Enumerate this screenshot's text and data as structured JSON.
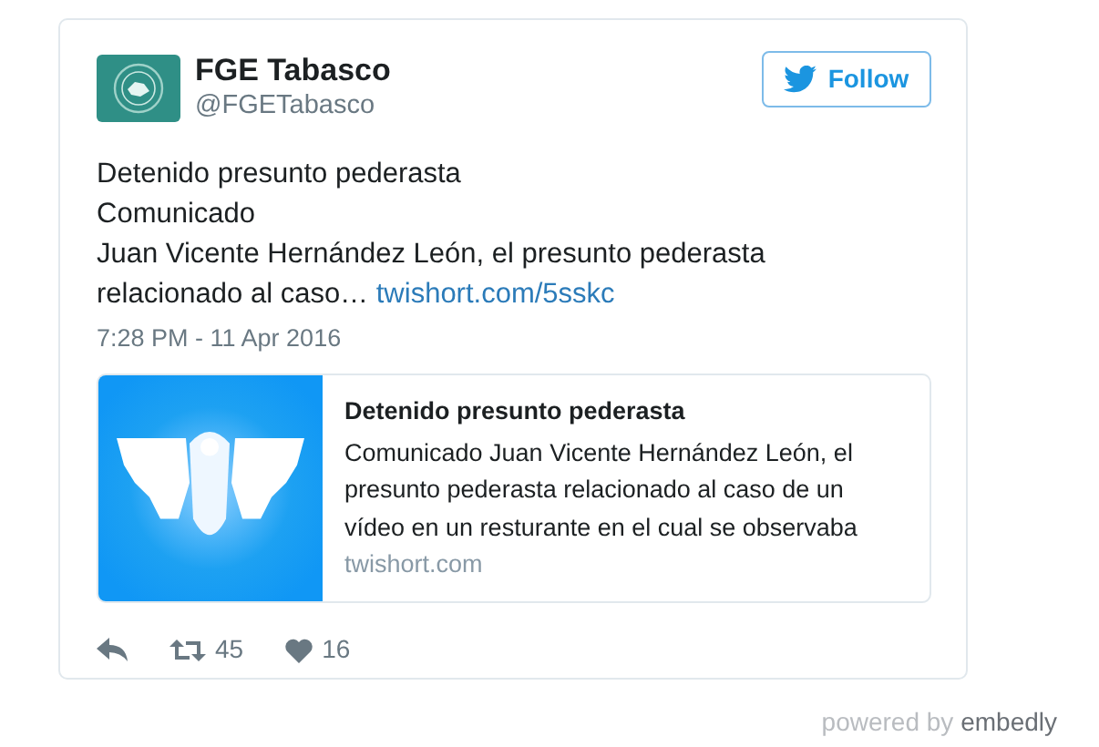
{
  "author": {
    "name": "FGE Tabasco",
    "handle": "@FGETabasco"
  },
  "follow_button": "Follow",
  "tweet": {
    "lines": [
      "Detenido presunto pederasta",
      "Comunicado",
      "Juan Vicente Hernández León, el presunto pederasta relacionado al caso…"
    ],
    "link": "twishort.com/5sskc"
  },
  "timestamp": "7:28 PM - 11 Apr 2016",
  "link_card": {
    "title": "Detenido presunto pederasta",
    "description": "Comunicado Juan Vicente Hernández León, el presunto pederasta relacionado al caso de un vídeo en un resturante en el cual se observaba",
    "domain": "twishort.com"
  },
  "actions": [
    {
      "kind": "reply"
    },
    {
      "kind": "retweet",
      "count": "45"
    },
    {
      "kind": "like",
      "count": "16"
    }
  ],
  "footer": {
    "prefix": "powered by",
    "brand": "embedly"
  }
}
